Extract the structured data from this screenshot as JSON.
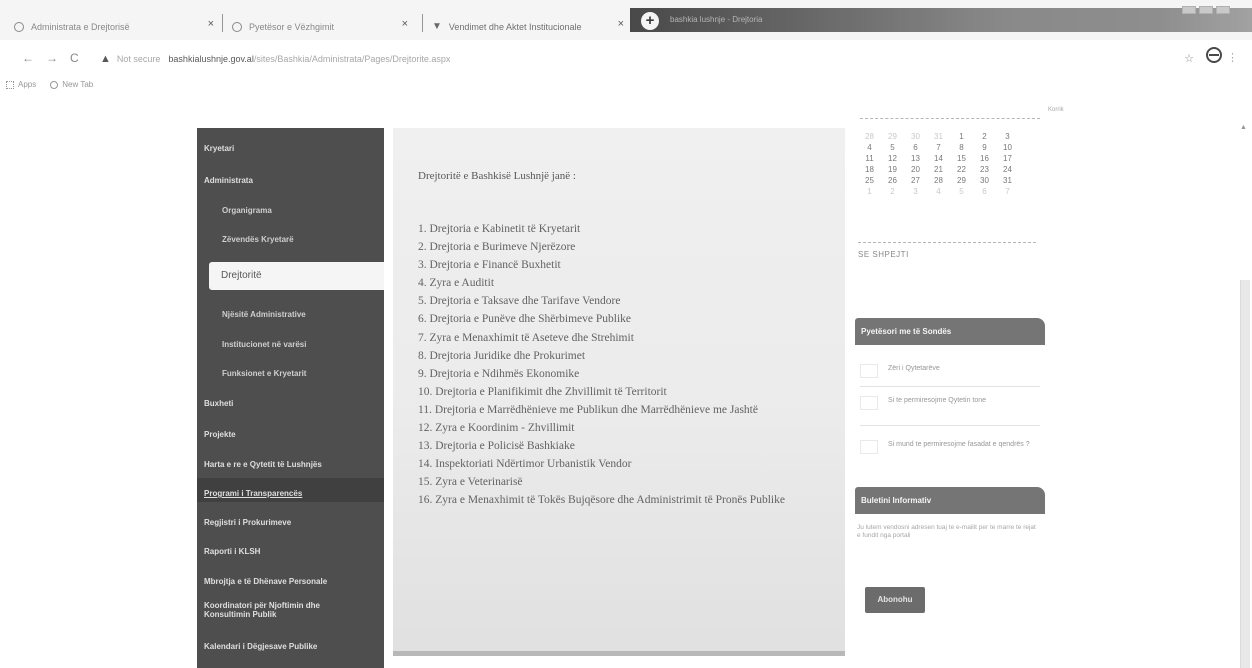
{
  "browser": {
    "tabs": [
      {
        "title": "Administrata e Drejtorisë"
      },
      {
        "title": "Pyetësor e Vëzhgimit"
      },
      {
        "title": "Vendimet dhe Aktet Institucionale"
      }
    ],
    "strip_text": "bashkia lushnje - Drejtoria",
    "address": {
      "security": "Not secure",
      "host": "bashkialushnje.gov.al",
      "path": "/sites/Bashkia/Administrata/Pages/Drejtorite.aspx"
    },
    "bookmarks": [
      {
        "label": "Apps"
      },
      {
        "label": "New Tab"
      }
    ]
  },
  "sidebar": {
    "items": [
      {
        "label": "Kryetari"
      },
      {
        "label": "Administrata"
      },
      {
        "label": "Organigrama"
      },
      {
        "label": "Zëvendës Kryetarë"
      },
      {
        "label": "Drejtoritë"
      },
      {
        "label": "Njësitë Administrative"
      },
      {
        "label": "Institucionet në varësi"
      },
      {
        "label": "Funksionet e Kryetarit"
      },
      {
        "label": "Buxheti"
      },
      {
        "label": "Projekte"
      },
      {
        "label": "Harta e re e Qytetit të Lushnjës"
      },
      {
        "label": "Programi i Transparencës"
      },
      {
        "label": "Regjistri i Prokurimeve"
      },
      {
        "label": "Raporti i KLSH"
      },
      {
        "label": "Mbrojtja e të Dhënave Personale"
      },
      {
        "label": "Koordinatori për Njoftimin dhe Konsultimin Publik"
      },
      {
        "label": "Kalendari i Dëgjesave Publike"
      }
    ]
  },
  "content": {
    "intro": "Drejtoritë e Bashkisë Lushnjë janë :",
    "departments": [
      "1. Drejtoria e Kabinetit të Kryetarit",
      "2. Drejtoria e Burimeve Njerëzore",
      "3. Drejtoria e Financë Buxhetit",
      "4. Zyra e Auditit",
      "5. Drejtoria e Taksave dhe Tarifave Vendore",
      "6. Drejtoria e Punëve dhe Shërbimeve Publike",
      "7. Zyra e Menaxhimit të Aseteve dhe Strehimit",
      "8. Drejtoria Juridike dhe Prokurimet",
      "9. Drejtoria e Ndihmës Ekonomike",
      "10. Drejtoria e Planifikimit dhe Zhvillimit të Territorit",
      "11. Drejtoria e Marrëdhënieve me Publikun dhe Marrëdhënieve me Jashtë",
      "12. Zyra e Koordinim - Zhvillimit",
      "13. Drejtoria e Policisë Bashkiake",
      "14. Inspektoriati Ndërtimor Urbanistik Vendor",
      "15. Zyra e Veterinarisë",
      "16. Zyra e Menaxhimit të Tokës Bujqësore dhe Administrimit të Pronës Publike"
    ]
  },
  "calendar": {
    "header": "Korrik",
    "weeks": [
      [
        "28",
        "29",
        "30",
        "31",
        "1",
        "2",
        "3"
      ],
      [
        "4",
        "5",
        "6",
        "7",
        "8",
        "9",
        "10"
      ],
      [
        "11",
        "12",
        "13",
        "14",
        "15",
        "16",
        "17"
      ],
      [
        "18",
        "19",
        "20",
        "21",
        "22",
        "23",
        "24"
      ],
      [
        "25",
        "26",
        "27",
        "28",
        "29",
        "30",
        "31"
      ],
      [
        "1",
        "2",
        "3",
        "4",
        "5",
        "6",
        "7"
      ]
    ],
    "more_link": "SE SHPEJTI"
  },
  "poll": {
    "title": "Pyetësori me të Sondës",
    "options": [
      "Zëri i Qytetarëve",
      "Si te permiresojme Qytetin tone",
      "Si mund te permiresojme fasadat e qendrës ?"
    ]
  },
  "newsletter": {
    "title": "Buletini Informativ",
    "description": "Ju lutem vendosni adresen tuaj te e-mailit per te marre te rejat e fundit nga portali",
    "button": "Abonohu"
  }
}
